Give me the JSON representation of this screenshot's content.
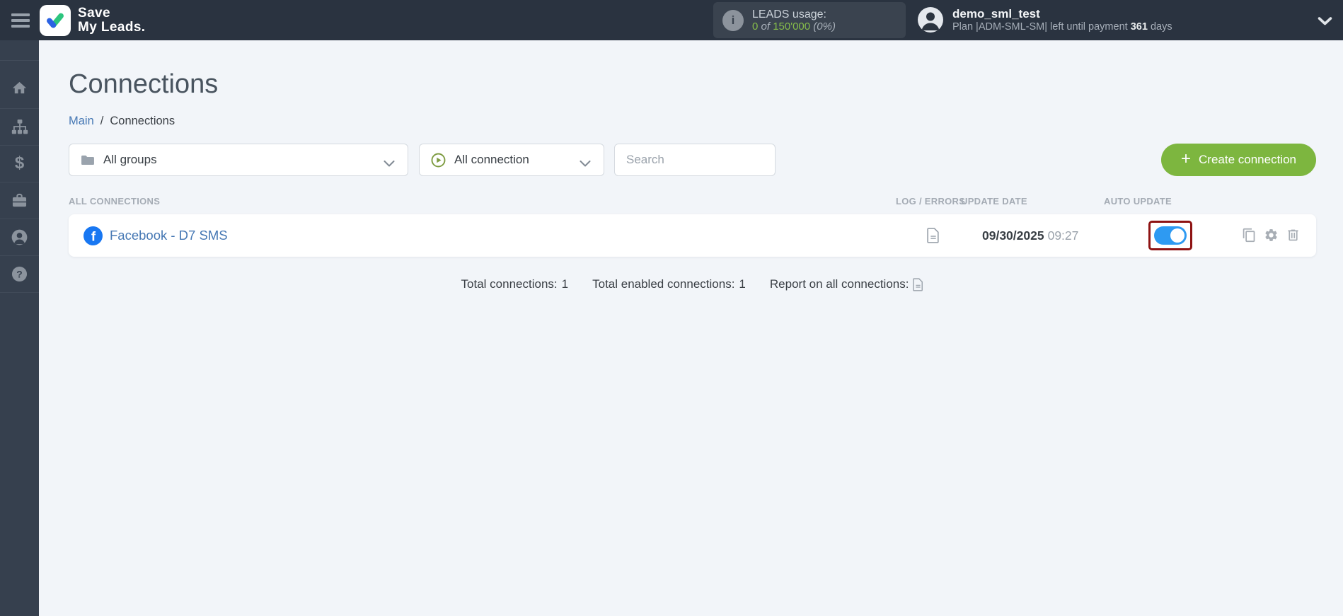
{
  "topbar": {
    "brand_line1": "Save",
    "brand_line2": "My Leads.",
    "leads": {
      "title": "LEADS usage:",
      "used": "0",
      "of_word": "of",
      "total": "150'000",
      "percent": "(0%)"
    },
    "user": {
      "name": "demo_sml_test",
      "plan_text": "Plan |ADM-SML-SM| left until payment",
      "days": "361",
      "days_word": "days"
    }
  },
  "sidebar": {
    "items": [
      "home-icon",
      "connections-tree-icon",
      "payments-dollar-icon",
      "services-briefcase-icon",
      "account-person-icon",
      "help-question-icon"
    ]
  },
  "icons": {
    "info_glyph": "i",
    "dollar_glyph": "$",
    "question_glyph": "?",
    "facebook_glyph": "f"
  },
  "page": {
    "title": "Connections",
    "breadcrumb_main": "Main",
    "breadcrumb_sep": "/",
    "breadcrumb_current": "Connections"
  },
  "filters": {
    "groups_value": "All groups",
    "connection_value": "All connection",
    "search_placeholder": "Search",
    "plus": "+",
    "create_label": "Create connection"
  },
  "table": {
    "headers": {
      "connections": "ALL CONNECTIONS",
      "log": "LOG / ERRORS",
      "date": "UPDATE DATE",
      "auto": "AUTO UPDATE"
    },
    "row": {
      "name": "Facebook - D7 SMS",
      "date": "09/30/2025",
      "time": "09:27",
      "auto_update": "on"
    }
  },
  "footer": {
    "total_label": "Total connections:",
    "total_value": "1",
    "enabled_label": "Total enabled connections:",
    "enabled_value": "1",
    "report_label": "Report on all connections:"
  },
  "colors": {
    "topbar_bg": "#2a3340",
    "sidebar_bg": "#36404e",
    "main_bg": "#f2f5f9",
    "accent_green": "#7db63f",
    "usage_green": "#86bd4a",
    "link_blue": "#4678b4",
    "facebook_blue": "#1877f2",
    "toggle_blue": "#2e9af2",
    "highlight_red": "#8e1313"
  }
}
